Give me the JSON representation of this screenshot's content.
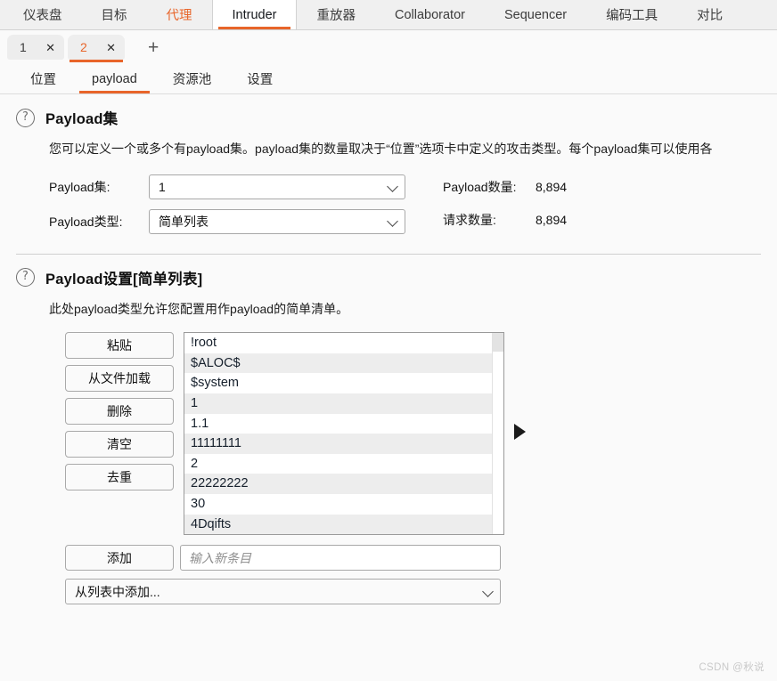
{
  "main_nav": {
    "items": [
      {
        "label": "仪表盘",
        "state": "normal"
      },
      {
        "label": "目标",
        "state": "normal"
      },
      {
        "label": "代理",
        "state": "highlight"
      },
      {
        "label": "Intruder",
        "state": "active"
      },
      {
        "label": "重放器",
        "state": "normal"
      },
      {
        "label": "Collaborator",
        "state": "normal"
      },
      {
        "label": "Sequencer",
        "state": "normal"
      },
      {
        "label": "编码工具",
        "state": "normal"
      },
      {
        "label": "对比",
        "state": "normal"
      }
    ]
  },
  "attack_tabs": {
    "tabs": [
      {
        "label": "1",
        "close": "✕",
        "active": false
      },
      {
        "label": "2",
        "close": "✕",
        "active": true
      }
    ],
    "add_label": "+"
  },
  "sub_tabs": {
    "items": [
      {
        "label": "位置",
        "active": false
      },
      {
        "label": "payload",
        "active": true
      },
      {
        "label": "资源池",
        "active": false
      },
      {
        "label": "设置",
        "active": false
      }
    ]
  },
  "payload_sets": {
    "help_icon": "?",
    "title": "Payload集",
    "description": "您可以定义一个或多个有payload集。payload集的数量取决于“位置”选项卡中定义的攻击类型。每个payload集可以使用各",
    "set_label": "Payload集:",
    "set_value": "1",
    "type_label": "Payload类型:",
    "type_value": "简单列表",
    "payload_count_label": "Payload数量:",
    "payload_count_value": "8,894",
    "request_count_label": "请求数量:",
    "request_count_value": "8,894"
  },
  "payload_settings": {
    "help_icon": "?",
    "title": "Payload设置[简单列表]",
    "description": "此处payload类型允许您配置用作payload的简单清单。",
    "buttons": [
      {
        "label": "粘贴",
        "name": "paste"
      },
      {
        "label": "从文件加载",
        "name": "load-from-file"
      },
      {
        "label": "删除",
        "name": "remove"
      },
      {
        "label": "清空",
        "name": "clear"
      },
      {
        "label": "去重",
        "name": "deduplicate"
      }
    ],
    "list_items": [
      "!root",
      "$ALOC$",
      "$system",
      "1",
      "1.1",
      "11111111",
      "2",
      "22222222",
      "30",
      "4Dqifts"
    ],
    "add_button_label": "添加",
    "add_input_placeholder": "输入新条目",
    "add_input_value": "",
    "add_from_list_label": "从列表中添加..."
  },
  "watermark": "CSDN @秋说"
}
